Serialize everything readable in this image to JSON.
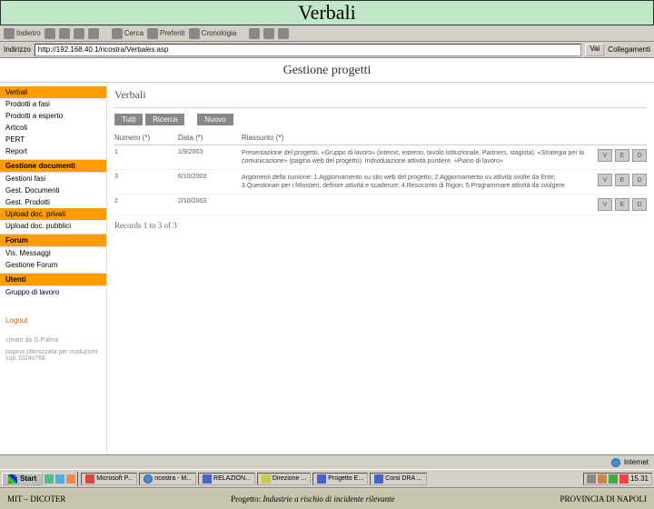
{
  "title": "Verbali",
  "toolbar": {
    "items": [
      "Indietro",
      "Avanti",
      "Cerca",
      "Preferiti",
      "Cronologia"
    ]
  },
  "address": {
    "label": "Indirizzo",
    "url": "http://192.168.40.1/ricostra/Verbales.asp",
    "go": "Vai",
    "links": "Collegamenti"
  },
  "page": {
    "header": "Gestione progetti",
    "section": "Verbali",
    "tabs": {
      "all": "Tutti",
      "search": "Ricerca",
      "new": "Nuovo"
    },
    "columns": {
      "num": "Numero (*)",
      "date": "Data (*)",
      "summary": "Riassunto (*)"
    },
    "rows": [
      {
        "num": "1",
        "date": "1/9/2003",
        "summary": "Presentazione del progetto. «Gruppo di lavoro» (interno, esterno, tavolo istituzionale, Partners, stagista). «Strategia per la comunicazione» (pagina web del progetto). Individuazione attività puntiere. «Piano di lavoro»"
      },
      {
        "num": "3",
        "date": "6/10/2003",
        "summary": "Argomenti della riunione: 1.Aggiornamento su sito web del progetto; 2.Aggiornamento su attività svolte da Ente; 3.Questionari per i Ministeri; definire attività e scadenze; 4.Resoconto di Rigon; 5.Programmare attività da svolgere"
      },
      {
        "num": "2",
        "date": "2/10/2003",
        "summary": ""
      }
    ],
    "actions": {
      "v": "V",
      "e": "E",
      "d": "D"
    },
    "records_label": "Records",
    "records_range": "1 to 3 of 3"
  },
  "sidebar": {
    "items": [
      {
        "label": "Verbali",
        "active": true
      },
      {
        "label": "Prodotti a fasi"
      },
      {
        "label": "Prodotti a esperto"
      },
      {
        "label": "Articoli"
      },
      {
        "label": "PERT"
      },
      {
        "label": "Report"
      }
    ],
    "group_docs_header": "Gestione documenti",
    "group_docs": [
      {
        "label": "Gestioni fasi"
      },
      {
        "label": "Gest. Documenti"
      },
      {
        "label": "Gest. Prodotti"
      },
      {
        "label": "Upload doc. privati"
      },
      {
        "label": "Upload doc. pubblici"
      }
    ],
    "group_forum_header": "Forum",
    "group_forum": [
      {
        "label": "Vis. Messaggi"
      },
      {
        "label": "Gestione Forum"
      }
    ],
    "group_users_header": "Utenti",
    "group_users": [
      {
        "label": "Gruppo di lavoro"
      }
    ],
    "logout": "Logout",
    "credit": "creato da G.Palma",
    "optim": "pagina ottimizzata per risoluzioni sup.1024x768"
  },
  "status": {
    "internet": "Internet"
  },
  "taskbar": {
    "start": "Start",
    "items": [
      "Microsoft P...",
      "ncostra - M...",
      "RELAZION...",
      "Direzione ...",
      "Progetto E...",
      "Corsi DRA ..."
    ],
    "time": "15.31"
  },
  "footer": {
    "left": "MIT – DICOTER",
    "center_prefix": "Progetto: ",
    "center_italic": "Industrie a rischio di incidente rilevante",
    "right": "PROVINCIA DI NAPOLI"
  }
}
